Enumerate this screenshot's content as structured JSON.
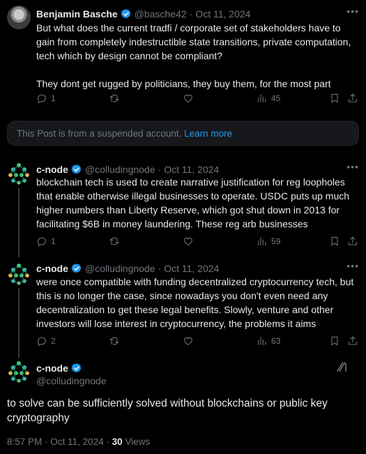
{
  "tweets": [
    {
      "name": "Benjamin Basche",
      "handle": "@basche42",
      "date": "Oct 11, 2024",
      "text": "But what does the current tradfi / corporate set of stakeholders have to gain from completely indestructible state transitions, private computation, tech which by design cannot be compliant?\n\nThey dont get rugged by politicians, they buy them, for the most part",
      "replies": "1",
      "reposts": "",
      "likes": "",
      "views": "45"
    },
    {
      "name": "c-node",
      "handle": "@colludingnode",
      "date": "Oct 11, 2024",
      "text": "blockchain tech is used to create narrative justification for reg loopholes that enable otherwise illegal businesses to operate. USDC puts up much higher numbers than Liberty Reserve, which got shut down in 2013 for facilitating $6B in money laundering. These reg arb businesses",
      "replies": "1",
      "reposts": "",
      "likes": "",
      "views": "59"
    },
    {
      "name": "c-node",
      "handle": "@colludingnode",
      "date": "Oct 11, 2024",
      "text": "were once compatible with funding decentralized cryptocurrency tech, but this is no longer the case, since nowadays you don't even need any decentralization to get these legal benefits. Slowly, venture and other investors will lose interest in cryptocurrency, the problems it aims",
      "replies": "2",
      "reposts": "",
      "likes": "",
      "views": "63"
    }
  ],
  "banner": {
    "text": "This Post is from a suspended account.",
    "link": "Learn more"
  },
  "main_tweet": {
    "name": "c-node",
    "handle": "@colludingnode",
    "text": "to solve can be sufficiently solved without blockchains or public key cryptography",
    "time": "8:57 PM",
    "date": "Oct 11, 2024",
    "views_count": "30",
    "views_label": "Views"
  },
  "separator": "·",
  "more_icon": "more-dots",
  "colors": {
    "background": "#000000",
    "text": "#e7e9ea",
    "muted": "#71767b",
    "accent": "#1d9bf0"
  }
}
